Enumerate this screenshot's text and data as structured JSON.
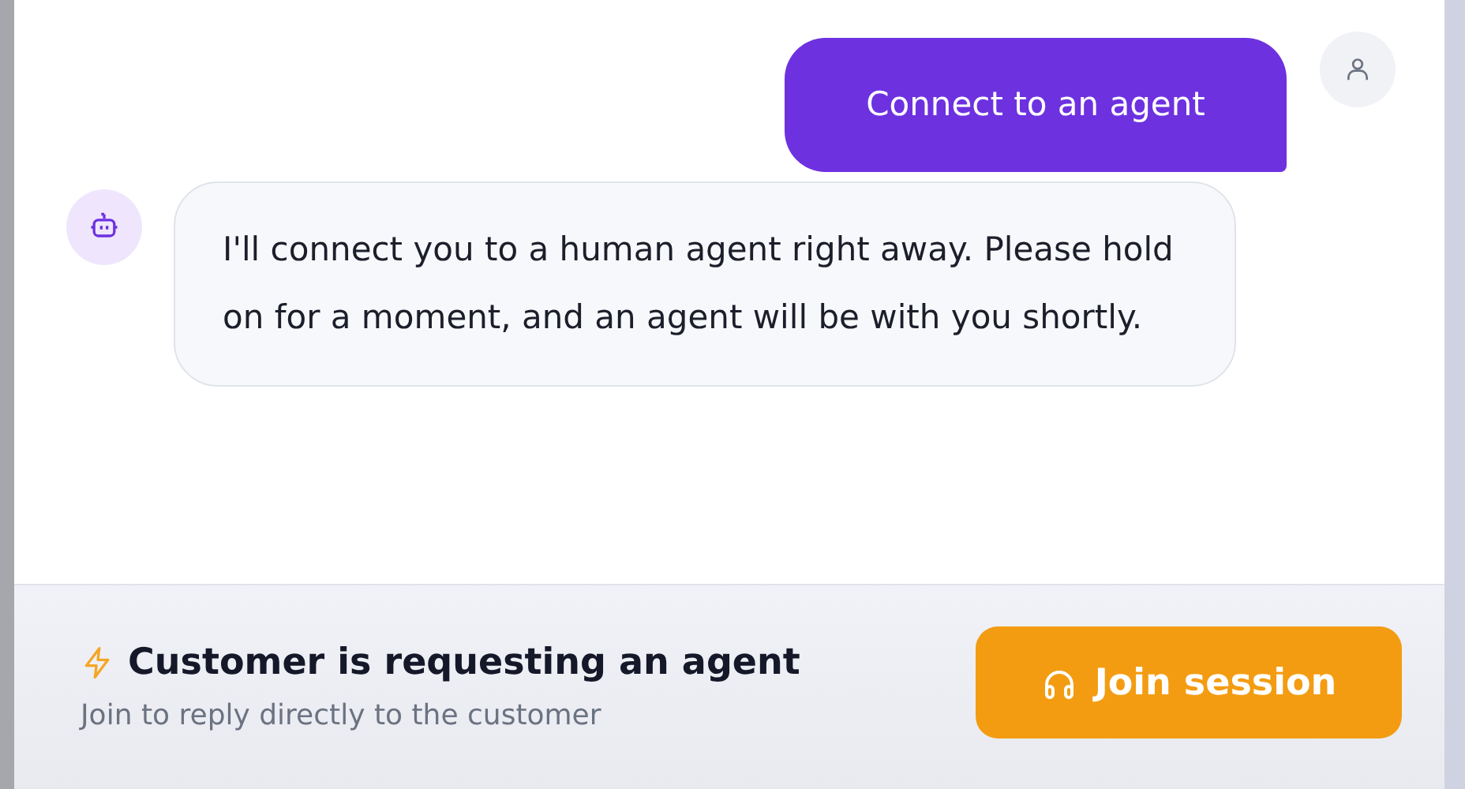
{
  "messages": [
    {
      "kind": "user",
      "text": "Connect to an agent"
    },
    {
      "kind": "bot",
      "text": "I'll connect you to a human agent right away. Please hold on for a moment, and an agent will be with you shortly."
    }
  ],
  "banner": {
    "title": "Customer is requesting an agent",
    "subtitle": "Join to reply directly to the customer",
    "button": "Join session"
  }
}
